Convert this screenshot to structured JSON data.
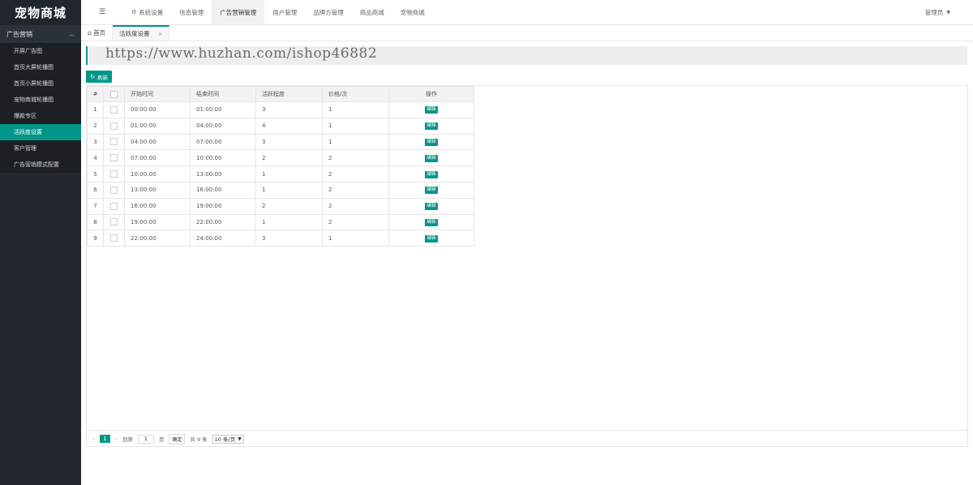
{
  "app": {
    "logo": "宠物商城"
  },
  "sidebar": {
    "group": "广告营销",
    "items": [
      {
        "label": "开屏广告图"
      },
      {
        "label": "首页大屏轮播图"
      },
      {
        "label": "首页小屏轮播图"
      },
      {
        "label": "宠物商城轮播图"
      },
      {
        "label": "爆款专区"
      },
      {
        "label": "活跃度设置"
      },
      {
        "label": "客户管理"
      },
      {
        "label": "广告营销模式配置"
      }
    ]
  },
  "topnav": {
    "items": [
      {
        "label": "系统设置"
      },
      {
        "label": "信息管理"
      },
      {
        "label": "广告营销管理"
      },
      {
        "label": "用户管理"
      },
      {
        "label": "品牌方管理"
      },
      {
        "label": "商品商城"
      },
      {
        "label": "宠物商城"
      }
    ],
    "user": "管理员"
  },
  "tabs": [
    {
      "label": "首页"
    },
    {
      "label": "活跃度设置"
    }
  ],
  "watermark": "https://www.huzhan.com/ishop46882",
  "toolbar": {
    "refresh_label": "刷新"
  },
  "table": {
    "headers": [
      "#",
      "",
      "开始时间",
      "结束时间",
      "活跃程度",
      "价格/次",
      "操作"
    ],
    "edit_label": "编辑",
    "rows": [
      {
        "idx": "1",
        "start": "00:00:00",
        "end": "01:00:00",
        "level": "3",
        "price": "1"
      },
      {
        "idx": "2",
        "start": "01:00:00",
        "end": "04:00:00",
        "level": "4",
        "price": "1"
      },
      {
        "idx": "3",
        "start": "04:00:00",
        "end": "07:00:00",
        "level": "3",
        "price": "1"
      },
      {
        "idx": "4",
        "start": "07:00:00",
        "end": "10:00:00",
        "level": "2",
        "price": "2"
      },
      {
        "idx": "5",
        "start": "10:00:00",
        "end": "13:00:00",
        "level": "1",
        "price": "2"
      },
      {
        "idx": "6",
        "start": "13:00:00",
        "end": "16:00:00",
        "level": "1",
        "price": "2"
      },
      {
        "idx": "7",
        "start": "16:00:00",
        "end": "19:00:00",
        "level": "2",
        "price": "2"
      },
      {
        "idx": "8",
        "start": "19:00:00",
        "end": "22:00:00",
        "level": "1",
        "price": "2"
      },
      {
        "idx": "9",
        "start": "22:00:00",
        "end": "24:00:00",
        "level": "3",
        "price": "1"
      }
    ]
  },
  "pager": {
    "current": "1",
    "goto_label": "到第",
    "page_value": "1",
    "page_unit": "页",
    "confirm_label": "确定",
    "total_label": "共 9 条",
    "page_size": "10 条/页"
  },
  "colors": {
    "accent": "#009688",
    "sidebar_bg": "#22282e"
  }
}
